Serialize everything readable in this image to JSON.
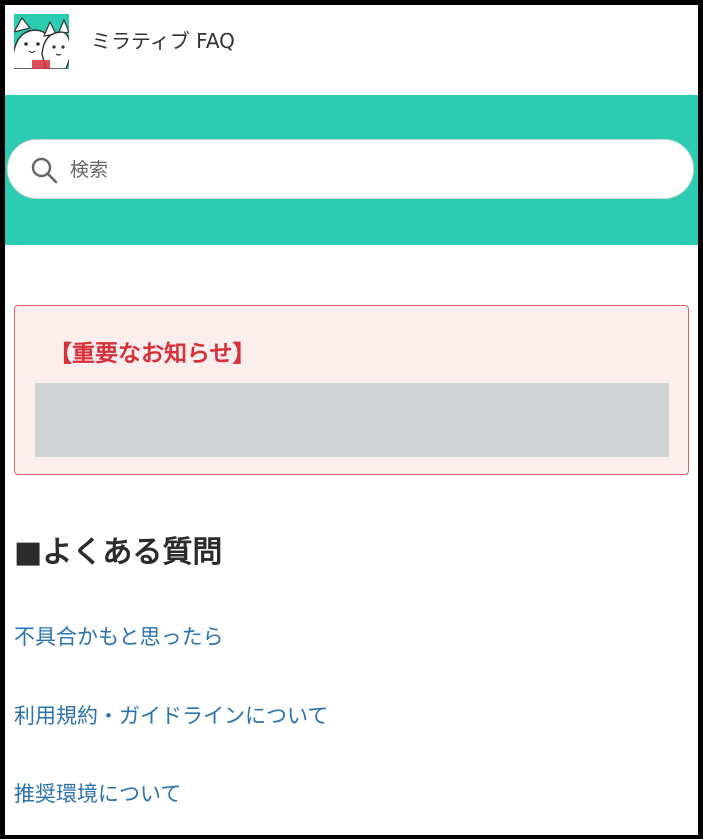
{
  "header": {
    "site_title": "ミラティブ FAQ",
    "logo_icon": "mascot-logo-icon"
  },
  "colors": {
    "accent": "#2bccb1",
    "notice_border": "#d9626b",
    "notice_background": "#fdeeee",
    "notice_title": "#d6303b",
    "link": "#2a72b0"
  },
  "search": {
    "placeholder": "検索",
    "value": "",
    "icon": "search-icon"
  },
  "notice": {
    "title": "【重要なお知らせ】"
  },
  "faq": {
    "heading": "■よくある質問",
    "links": [
      "不具合かもと思ったら",
      "利用規約・ガイドラインについて",
      "推奨環境について"
    ]
  }
}
